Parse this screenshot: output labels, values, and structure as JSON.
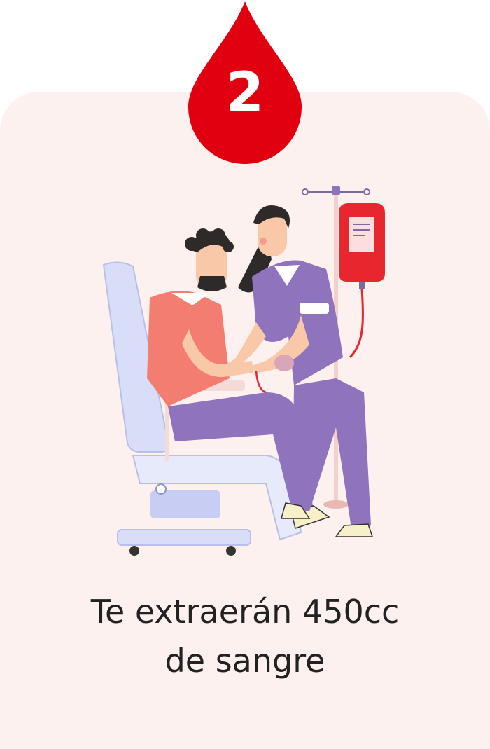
{
  "step": {
    "number": "2",
    "drop_color": "#e1000f",
    "icon": "blood-drop-icon"
  },
  "illustration": {
    "icon": "blood-donation-illustration"
  },
  "caption": {
    "line1": "Te extraerán 450cc",
    "line2": "de sangre"
  },
  "colors": {
    "card_background": "#fdf1ef",
    "text": "#222222",
    "nurse_uniform": "#8f73bd",
    "patient_shirt": "#f47d72",
    "blood_bag": "#e8262d"
  }
}
